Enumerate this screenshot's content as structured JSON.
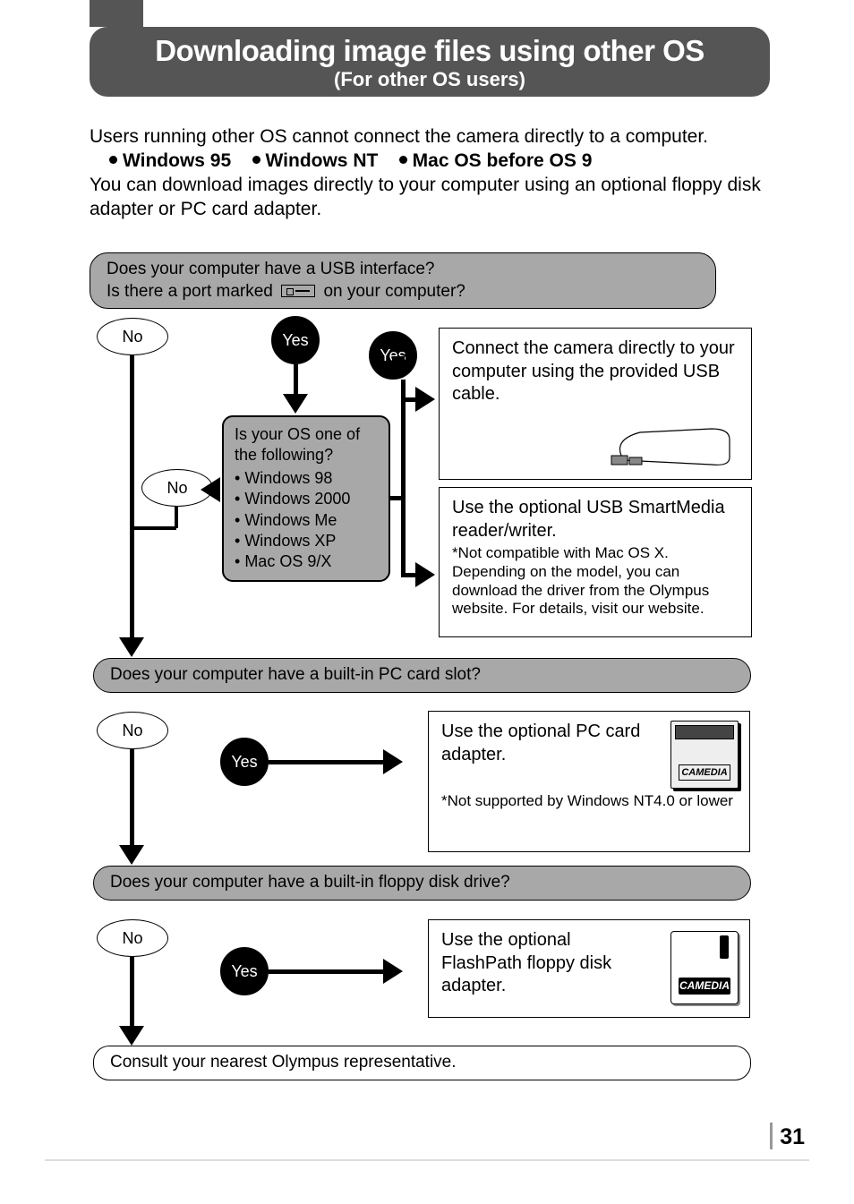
{
  "header": {
    "title": "Downloading image files using other OS",
    "subtitle": "(For other OS users)"
  },
  "intro": {
    "line1": "Users running other OS cannot connect the camera directly to a computer.",
    "os1": "Windows 95",
    "os2": "Windows NT",
    "os3": "Mac OS before OS 9",
    "line2": "You can download images directly to your computer using an optional floppy disk adapter or PC card adapter."
  },
  "questions": {
    "q1a": "Does your computer have a USB interface?",
    "q1b_pre": "Is there a port marked",
    "q1b_post": "on your computer?",
    "q4": "Does your computer have a built-in PC card slot?",
    "q5": "Does your computer have a built-in floppy disk drive?",
    "q6": "Consult your nearest Olympus representative."
  },
  "labels": {
    "yes": "Yes",
    "no": "No"
  },
  "os_box": {
    "prompt": "Is your OS one of the following?",
    "items": [
      "Windows 98",
      "Windows 2000",
      "Windows Me",
      "Windows XP",
      "Mac OS 9/X"
    ]
  },
  "results": {
    "r1": "Connect the camera directly to your computer using the provided USB cable.",
    "r2_main": "Use the optional USB SmartMedia reader/writer.",
    "r2_note": "*Not compatible with Mac OS X. Depending on the model, you can download the driver from the Olympus website. For details, visit our website.",
    "r3_main": "Use the optional PC card adapter.",
    "r3_note": "*Not supported by Windows NT4.0 or lower",
    "r4": "Use the optional FlashPath floppy disk adapter.",
    "card_label": "CAMEDIA",
    "floppy_label": "CAMEDIA"
  },
  "page_number": "31"
}
